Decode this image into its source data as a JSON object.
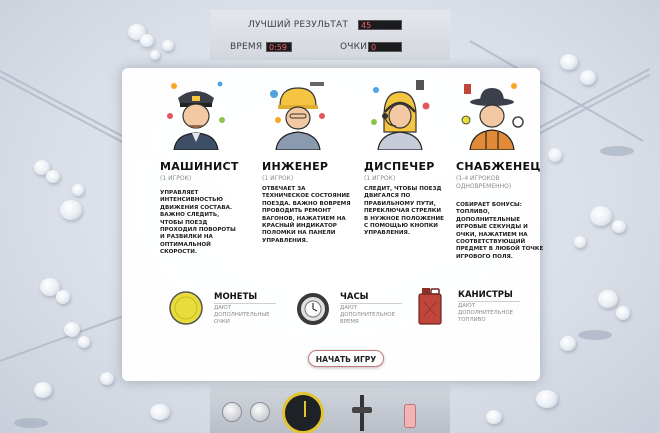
{
  "hud": {
    "best_label": "ЛУЧШИЙ РЕЗУЛЬТАТ",
    "best_value": "45",
    "time_label": "ВРЕМЯ",
    "time_value": "0:59",
    "score_label": "ОЧКИ",
    "score_value": "0"
  },
  "roles": [
    {
      "title": "МАШИНИСТ",
      "players": "(1 ИГРОК)",
      "description": "УПРАВЛЯЕТ ИНТЕНСИВНОСТЬЮ ДВИЖЕНИЯ СОСТАВА. ВАЖНО СЛЕДИТЬ, ЧТОБЫ ПОЕЗД ПРОХОДИЛ ПОВОРОТЫ И РАЗВИЛКИ НА ОПТИМАЛЬНОЙ СКОРОСТИ.",
      "icon": "driver-icon"
    },
    {
      "title": "ИНЖЕНЕР",
      "players": "(1 ИГРОК)",
      "description": "ОТВЕЧАЕТ ЗА ТЕХНИЧЕСКОЕ СОСТОЯНИЕ ПОЕЗДА. ВАЖНО ВОВРЕМЯ ПРОВОДИТЬ РЕМОНТ ВАГОНОВ, НАЖАТИЕМ НА КРАСНЫЙ ИНДИКАТОР ПОЛОМКИ НА ПАНЕЛИ УПРАВЛЕНИЯ.",
      "icon": "engineer-icon"
    },
    {
      "title": "ДИСПЕЧЕР",
      "players": "(1 ИГРОК)",
      "description": "СЛЕДИТ, ЧТОБЫ ПОЕЗД ДВИГАЛСЯ ПО ПРАВИЛЬНОМУ ПУТИ, ПЕРЕКЛЮЧАЯ СТРЕЛКИ В НУЖНОЕ ПОЛОЖЕНИЕ С ПОМОЩЬЮ КНОПКИ УПРАВЛЕНИЯ.",
      "icon": "dispatcher-icon"
    },
    {
      "title": "СНАБЖЕНЕЦ",
      "players": "(1-4 ИГРОКОВ ОДНОВРЕМЕННО)",
      "description": "СОБИРАЕТ БОНУСЫ: ТОПЛИВО, ДОПОЛНИТЕЛЬНЫЕ ИГРОВЫЕ СЕКУНДЫ И ОЧКИ, НАЖАТИЕМ НА СООТВЕТСТВУЮЩИЙ ПРЕДМЕТ В ЛЮБОЙ ТОЧКЕ ИГРОВОГО ПОЛЯ.",
      "icon": "supplier-icon"
    }
  ],
  "bonuses": [
    {
      "title": "МОНЕТЫ",
      "description": "ДАЮТ ДОПОЛНИТЕЛЬНЫЕ ОЧКИ",
      "icon": "coin-icon"
    },
    {
      "title": "ЧАСЫ",
      "description": "ДАЮТ ДОПОЛНИТЕЛЬНОЕ ВРЕМЯ",
      "icon": "clock-icon"
    },
    {
      "title": "КАНИСТРЫ",
      "description": "ДАЮТ ДОПОЛНИТЕЛЬНОЕ ТОПЛИВО",
      "icon": "canister-icon"
    }
  ],
  "start_button": "НАЧАТЬ ИГРУ",
  "colors": {
    "hud_value": "#e66666",
    "coin": "#e8dc3a",
    "canister": "#c0463c",
    "gauge_ring": "#e3c431",
    "button_border": "#c47a7a"
  }
}
